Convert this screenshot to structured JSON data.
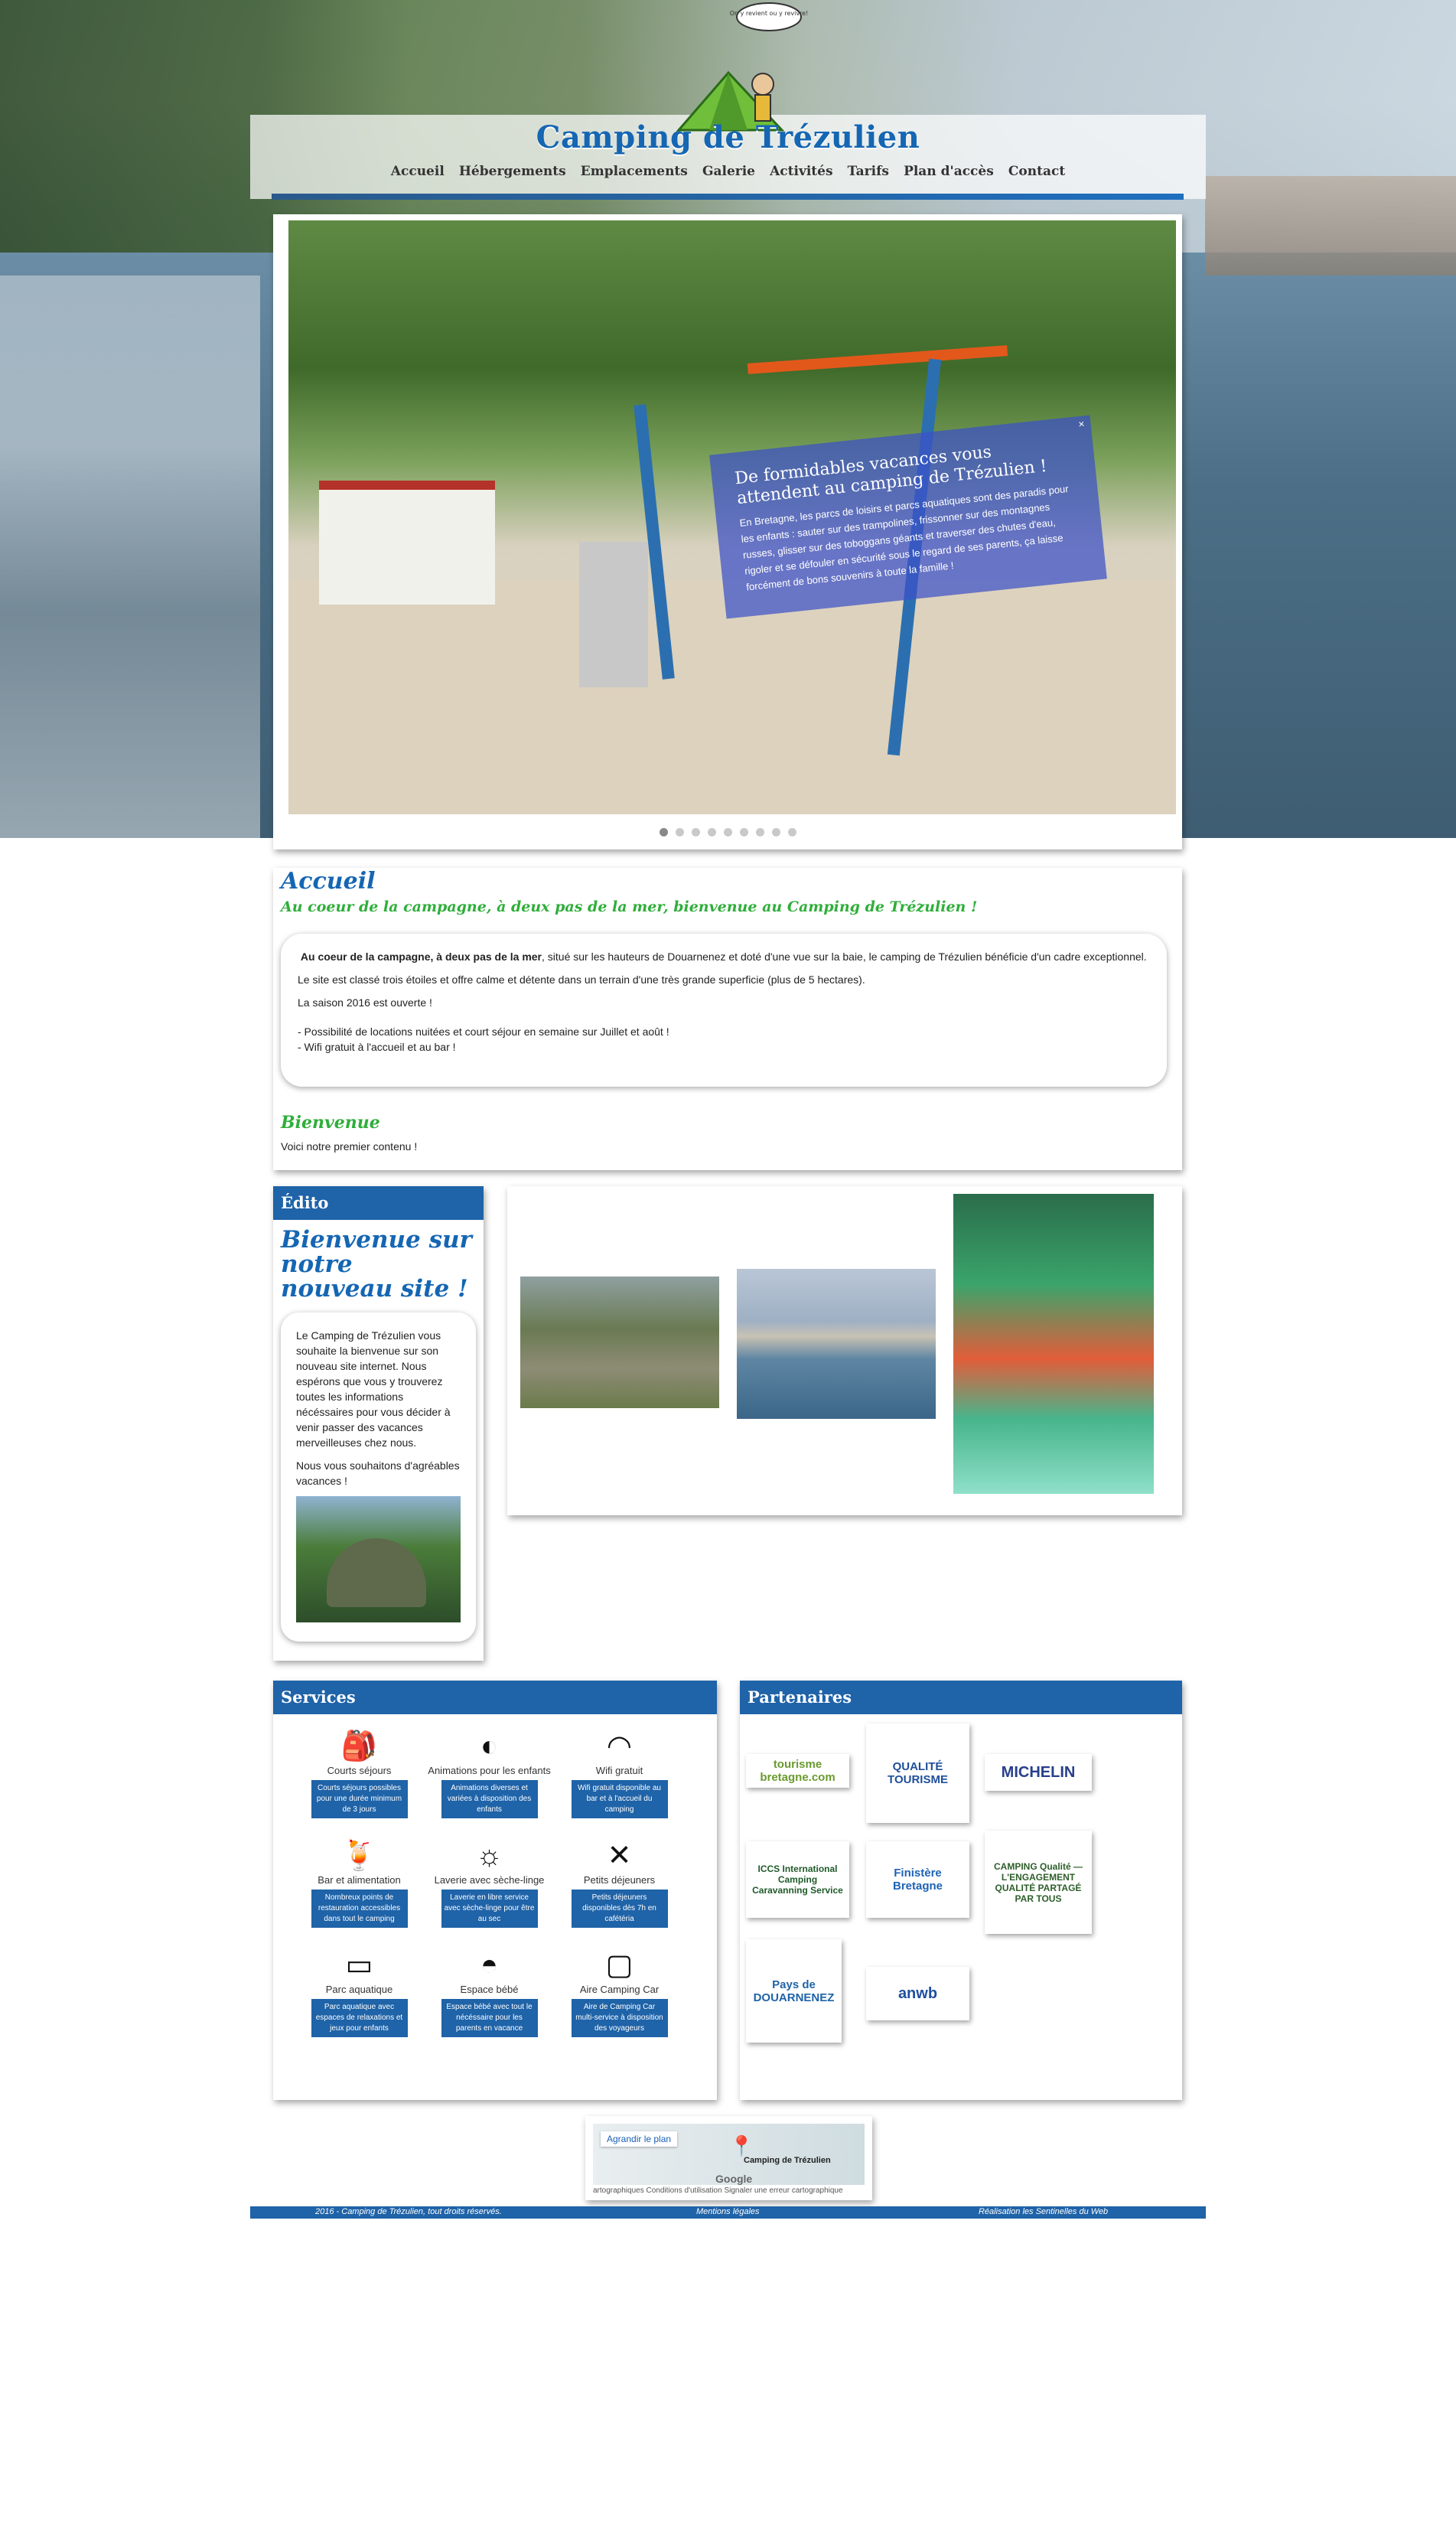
{
  "header": {
    "site_title": "Camping de Trézulien",
    "bubble_text": "On y revient ou y revivre!",
    "nav": [
      "Accueil",
      "Hébergements",
      "Emplacements",
      "Galerie",
      "Activités",
      "Tarifs",
      "Plan d'accès",
      "Contact"
    ]
  },
  "slider": {
    "caption_title": "De formidables vacances vous attendent au camping de Trézulien !",
    "caption_text": "En Bretagne, les parcs de loisirs et parcs aquatiques sont des paradis pour les enfants : sauter sur des trampolines, frissonner sur des montagnes russes, glisser sur des toboggans géants et traverser des chutes d'eau, rigoler et se défouler en sécurité sous le regard de ses parents, ça laisse forcément de bons souvenirs à toute la famille !",
    "close_symbol": "×",
    "dots_count": 9,
    "active_dot": 0
  },
  "accueil": {
    "title": "Accueil",
    "subtitle": "Au coeur de la campagne, à deux pas de la mer, bienvenue au Camping de Trézulien !",
    "p1_bold": "Au coeur de la campagne, à deux pas de la mer",
    "p1_rest": ", situé sur les hauteurs de Douarnenez et doté d'une vue sur la baie, le camping de Trézulien bénéficie d'un cadre exceptionnel.",
    "p2": "Le site est classé trois étoiles et offre calme et détente dans un terrain d'une très grande superficie (plus de 5 hectares).",
    "p3": "La saison 2016 est ouverte !",
    "p4": "- Possibilité de locations nuitées et court séjour en semaine sur Juillet et août !",
    "p5": "- Wifi gratuit à l'accueil et au bar !",
    "bienvenue_title": "Bienvenue",
    "bienvenue_text": "Voici notre premier contenu !"
  },
  "edito": {
    "header": "Édito",
    "title": "Bienvenue sur notre nouveau site !",
    "p1": "Le Camping de Trézulien vous souhaite la bienvenue sur son nouveau site internet. Nous espérons que vous y trouverez toutes les informations nécéssaires pour vous décider à venir passer des vacances merveilleuses chez nous.",
    "p2": "Nous vous souhaitons d'agréables vacances !"
  },
  "services": {
    "header": "Services",
    "items": [
      {
        "icon": "backpack-icon",
        "glyph": "🎒",
        "label": "Courts séjours",
        "desc": "Courts séjours possibles pour une durée minimum de 3 jours"
      },
      {
        "icon": "beach-ball-icon",
        "glyph": "◐",
        "label": "Animations pour les enfants",
        "desc": "Animations diverses et variées à disposition des enfants"
      },
      {
        "icon": "wifi-icon",
        "glyph": "◠",
        "label": "Wifi gratuit",
        "desc": "Wifi gratuit disponible au bar et à l'accueil du camping"
      },
      {
        "icon": "drink-icon",
        "glyph": "🍹",
        "label": "Bar et alimentation",
        "desc": "Nombreux points de restauration accessibles dans tout le camping"
      },
      {
        "icon": "sun-icon",
        "glyph": "☼",
        "label": "Laverie avec sèche-linge",
        "desc": "Laverie en libre service avec sèche-linge pour être au sec"
      },
      {
        "icon": "cutlery-icon",
        "glyph": "✕",
        "label": "Petits déjeuners",
        "desc": "Petits déjeuners disponibles dès 7h en cafétéria"
      },
      {
        "icon": "swim-shorts-icon",
        "glyph": "▭",
        "label": "Parc aquatique",
        "desc": "Parc aquatique avec espaces de relaxations et jeux pour enfants"
      },
      {
        "icon": "baby-icon",
        "glyph": "◓",
        "label": "Espace bébé",
        "desc": "Espace bébé avec tout le nécéssaire pour les parents en vacance"
      },
      {
        "icon": "camper-icon",
        "glyph": "▢",
        "label": "Aire Camping Car",
        "desc": "Aire de Camping Car multi-service à disposition des voyageurs"
      }
    ]
  },
  "partners": {
    "header": "Partenaires",
    "logos": [
      {
        "name": "tourisme-bretagne-logo",
        "text": "tourisme bretagne.com",
        "color": "#6a9a2e"
      },
      {
        "name": "qualite-tourisme-logo",
        "text": "QUALITÉ TOURISME",
        "color": "#1f4f9a"
      },
      {
        "name": "michelin-logo",
        "text": "MICHELIN",
        "color": "#27408b"
      },
      {
        "name": "iccs-logo",
        "text": "ICCS International Camping Caravanning Service",
        "color": "#1f5a2a"
      },
      {
        "name": "finistere-logo",
        "text": "Finistère Bretagne",
        "color": "#1e63b5"
      },
      {
        "name": "camping-qualite-logo",
        "text": "CAMPING Qualité — L'ENGAGEMENT QUALITÉ PARTAGÉ PAR TOUS",
        "color": "#2d5f2a"
      },
      {
        "name": "pays-de-douarnenez-logo",
        "text": "Pays de DOUARNENEZ",
        "color": "#1f63a8"
      },
      {
        "name": "anwb-logo",
        "text": "anwb",
        "color": "#1f4fa0"
      }
    ]
  },
  "map": {
    "button": "Agrandir le plan",
    "place": "Camping de Trézulien",
    "google": "Google",
    "footer": "artographiques    Conditions d'utilisation    Signaler une erreur cartographique"
  },
  "footer": {
    "copyright": "2016 - Camping de Trézulien, tout droits réservés.",
    "legal": "Mentions légales",
    "credit": "Réalisation les Sentinelles du Web"
  },
  "colors": {
    "brand_blue": "#1f63a8",
    "title_blue": "#1566b3",
    "green": "#2fae3a"
  }
}
